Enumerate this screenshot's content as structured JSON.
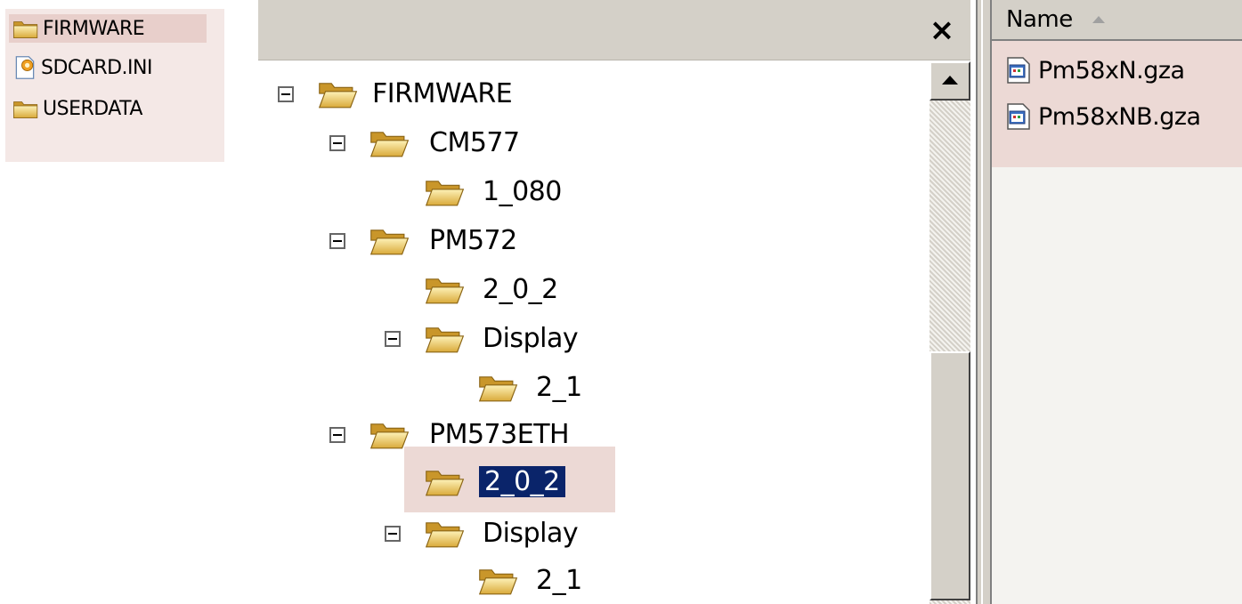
{
  "left_list": {
    "items": [
      {
        "label": "FIRMWARE",
        "icon": "folder-icon",
        "selected": true
      },
      {
        "label": "SDCARD.INI",
        "icon": "ini-file-icon",
        "selected": false
      },
      {
        "label": "USERDATA",
        "icon": "folder-icon",
        "selected": false
      }
    ]
  },
  "tree": {
    "close_label": "×",
    "nodes": [
      {
        "label": "FIRMWARE",
        "expanded": true
      },
      {
        "label": "CM577",
        "expanded": true
      },
      {
        "label": "1_080"
      },
      {
        "label": "PM572",
        "expanded": true
      },
      {
        "label": "2_0_2"
      },
      {
        "label": "Display",
        "expanded": true
      },
      {
        "label": "2_1"
      },
      {
        "label": "PM573ETH",
        "expanded": true
      },
      {
        "label": "2_0_2",
        "selected": true
      },
      {
        "label": "Display",
        "expanded": true
      },
      {
        "label": "2_1"
      }
    ]
  },
  "file_list": {
    "column_name": "Name",
    "sort": "ascending",
    "files": [
      {
        "label": "Pm58xN.gza",
        "icon": "gza-file-icon"
      },
      {
        "label": "Pm58xNB.gza",
        "icon": "gza-file-icon"
      }
    ]
  },
  "colors": {
    "selection": "#0a246a",
    "highlight": "#ecd9d5",
    "chrome": "#d4d0c8",
    "folder": "#e8c862"
  }
}
